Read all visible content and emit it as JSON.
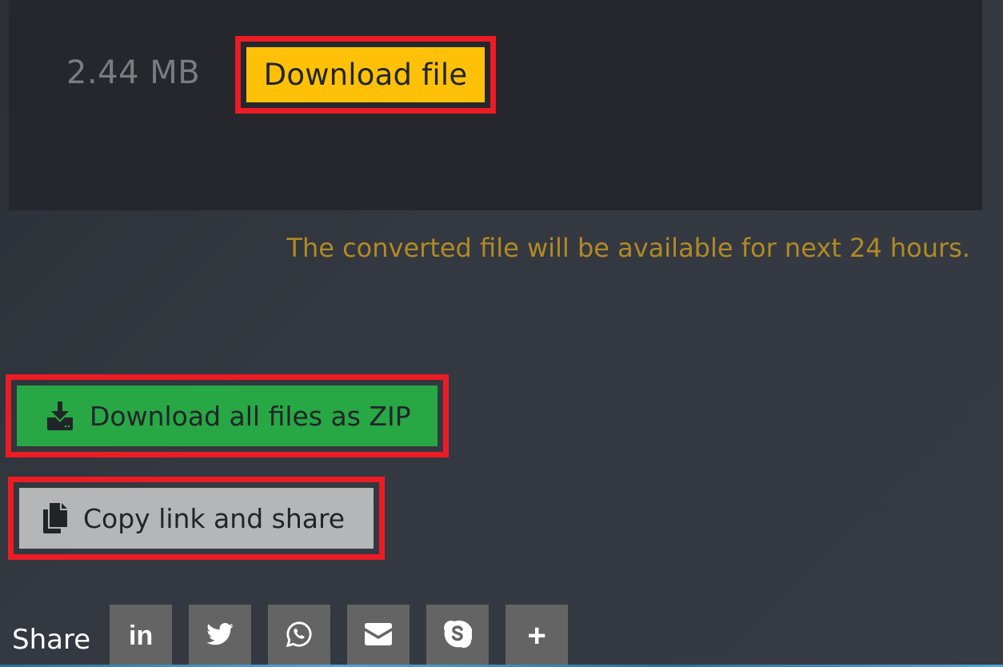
{
  "file_card": {
    "file_size": "2.44 MB",
    "download_file_label": "Download file"
  },
  "notice": "The converted file will be available for next 24 hours.",
  "actions": {
    "download_zip_label": "Download all files as ZIP",
    "copy_link_label": "Copy link and share"
  },
  "share": {
    "label": "Share",
    "buttons": [
      {
        "name": "linkedin",
        "icon": "linkedin-icon",
        "glyph": "in"
      },
      {
        "name": "twitter",
        "icon": "twitter-icon"
      },
      {
        "name": "whatsapp",
        "icon": "whatsapp-icon"
      },
      {
        "name": "email",
        "icon": "envelope-icon"
      },
      {
        "name": "skype",
        "icon": "skype-icon"
      },
      {
        "name": "more",
        "icon": "plus-icon",
        "glyph": "+"
      }
    ]
  },
  "colors": {
    "download_file_bg": "#ffc107",
    "download_zip_bg": "#28a745",
    "copy_link_bg": "#b5b6b7",
    "notice_text": "#b08a25",
    "highlight_border": "#ec1c24",
    "share_button_bg": "#646464"
  }
}
